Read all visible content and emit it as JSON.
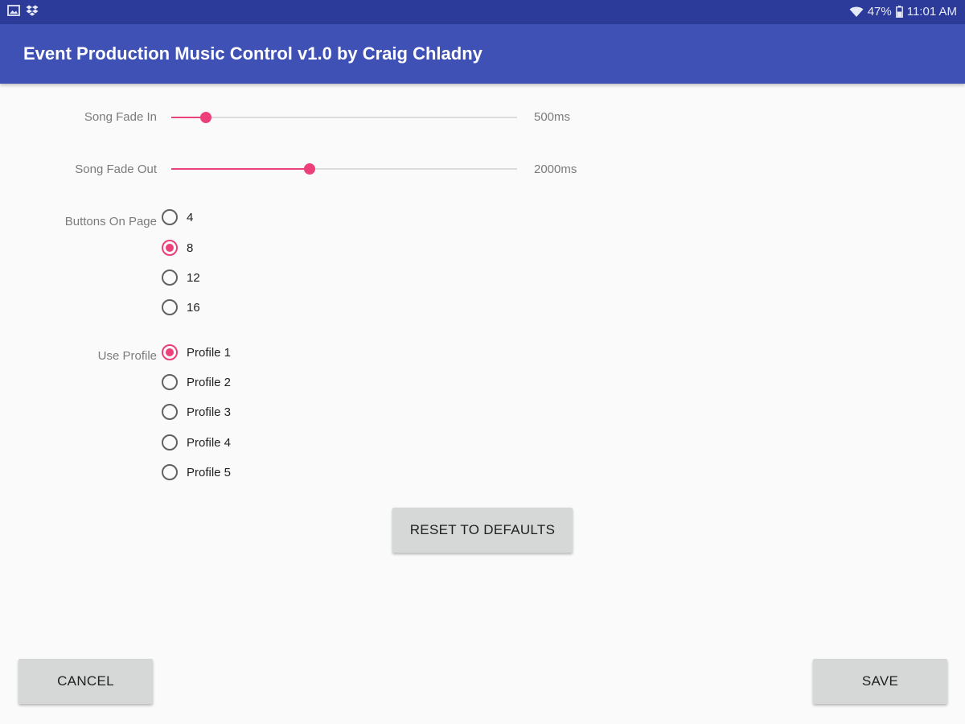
{
  "status_bar": {
    "left_icons": [
      "image-icon",
      "dropbox-icon"
    ],
    "right_icons": [
      "wifi-icon",
      "battery-icon"
    ],
    "battery": "47%",
    "time": "11:01 AM"
  },
  "app_bar": {
    "title": "Event Production Music Control v1.0 by Craig Chladny"
  },
  "settings": {
    "fade_in": {
      "label": "Song Fade In",
      "value_text": "500ms",
      "level": 0.1
    },
    "fade_out": {
      "label": "Song Fade Out",
      "value_text": "2000ms",
      "level": 0.4
    },
    "buttons_on_page": {
      "label": "Buttons On Page",
      "options": [
        "4",
        "8",
        "12",
        "16"
      ],
      "selected": "8"
    },
    "use_profile": {
      "label": "Use Profile",
      "options": [
        "Profile 1",
        "Profile 2",
        "Profile 3",
        "Profile 4",
        "Profile 5"
      ],
      "selected": "Profile 1"
    }
  },
  "actions": {
    "reset_label": "RESET TO DEFAULTS",
    "cancel_label": "CANCEL",
    "save_label": "SAVE"
  },
  "colors": {
    "status_bar": "#2c3a99",
    "app_bar": "#3f51b5",
    "accent": "#ec407a",
    "background": "#fafafa",
    "button": "#d6d7d7"
  }
}
